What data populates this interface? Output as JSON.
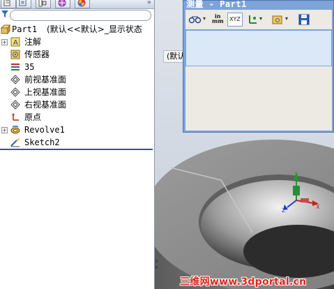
{
  "feature_tree": {
    "root_label": "Part1",
    "root_config": "(默认<<默认>_显示状态",
    "items": [
      {
        "label": "注解",
        "icon": "annotations-icon",
        "expandable": true
      },
      {
        "label": "传感器",
        "icon": "sensors-icon",
        "expandable": false
      },
      {
        "label": "35",
        "icon": "material-icon",
        "expandable": false
      },
      {
        "label": "前视基准面",
        "icon": "plane-icon",
        "expandable": false
      },
      {
        "label": "上视基准面",
        "icon": "plane-icon",
        "expandable": false
      },
      {
        "label": "右视基准面",
        "icon": "plane-icon",
        "expandable": false
      },
      {
        "label": "原点",
        "icon": "origin-icon",
        "expandable": false
      },
      {
        "label": "Revolve1",
        "icon": "revolve-icon",
        "expandable": true
      },
      {
        "label": "Sketch2",
        "icon": "sketch-icon",
        "expandable": false
      }
    ]
  },
  "graphics": {
    "config_label": "(默认"
  },
  "measure_dialog": {
    "title": "测量 - Part1",
    "units_label_top": "in",
    "units_label_bottom": "mm",
    "xyz_label": "XYZ"
  },
  "watermark": "三维网www.3dportal.cn",
  "colors": {
    "accent_blue": "#1c5aa8",
    "dialog_title_bg": "#7ea3d9",
    "result_bg": "#dbe8f7",
    "watermark_red": "#e0241b"
  }
}
